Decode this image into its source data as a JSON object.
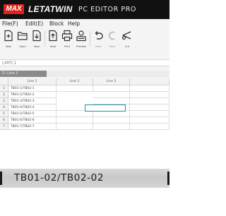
{
  "title_bar": {
    "logo": "MAX",
    "app_name": "LETATWIN",
    "app_subtitle": "PC EDITOR PRO",
    "background": "#111111",
    "logo_color": "#e0231a"
  },
  "menu": {
    "items": [
      "File(F)",
      "Edit(E)",
      "Block",
      "Help"
    ]
  },
  "toolbar": {
    "buttons": [
      {
        "label": "New",
        "icon": "new-document-icon"
      },
      {
        "label": "Open",
        "icon": "open-folder-icon"
      },
      {
        "label": "Save",
        "icon": "save-document-icon"
      },
      {
        "label": "Send",
        "icon": "send-document-icon"
      },
      {
        "label": "Print",
        "icon": "print-icon"
      },
      {
        "label": "Preview",
        "icon": "preview-icon"
      },
      {
        "label": "Undo",
        "icon": "undo-icon"
      },
      {
        "label": "Redo",
        "icon": "redo-icon"
      },
      {
        "label": "Cut",
        "icon": "cut-icon"
      }
    ]
  },
  "file": {
    "name": "LMPC1"
  },
  "sheet": {
    "tab_label": "D: Line 2"
  },
  "grid": {
    "columns": [
      "Line 1",
      "Line 2",
      "Line 3"
    ],
    "rows": [
      {
        "num": "1",
        "line1": "TB01-1/TB02-1"
      },
      {
        "num": "2",
        "line1": "TB01-2/TB02-2"
      },
      {
        "num": "3",
        "line1": "TB01-3/TB02-3"
      },
      {
        "num": "4",
        "line1": "TB01-4/TB02-4"
      },
      {
        "num": "5",
        "line1": "TB01-5/TB02-5"
      },
      {
        "num": "6",
        "line1": "TB01-6/TB02-6"
      },
      {
        "num": "7",
        "line1": "TB01-7/TB02-7"
      }
    ],
    "selected_cell": {
      "row": "2",
      "column": "Line 2"
    }
  },
  "zoom": {
    "text": "TB01-02/TB02-02"
  }
}
